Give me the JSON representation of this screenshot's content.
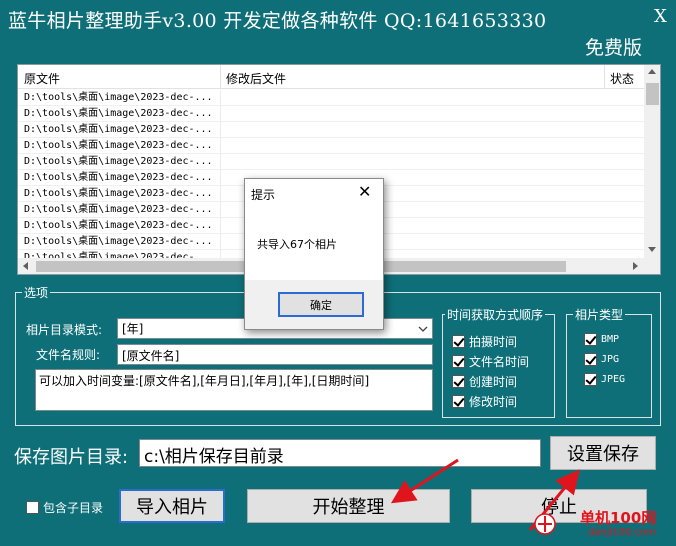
{
  "window": {
    "title": "蓝牛相片整理助手v3.00   开发定做各种软件   QQ:1641653330",
    "close": "X",
    "edition": "免费版"
  },
  "file_list": {
    "columns": [
      "原文件",
      "修改后文件",
      "状态"
    ],
    "rows": [
      "D:\\tools\\桌面\\image\\2023-dec-...",
      "D:\\tools\\桌面\\image\\2023-dec-...",
      "D:\\tools\\桌面\\image\\2023-dec-...",
      "D:\\tools\\桌面\\image\\2023-dec-...",
      "D:\\tools\\桌面\\image\\2023-dec-...",
      "D:\\tools\\桌面\\image\\2023-dec-...",
      "D:\\tools\\桌面\\image\\2023-dec-...",
      "D:\\tools\\桌面\\image\\2023-dec-...",
      "D:\\tools\\桌面\\image\\2023-dec-...",
      "D:\\tools\\桌面\\image\\2023-dec-...",
      "D:\\tools\\桌面\\image\\2023-dec-..."
    ]
  },
  "options": {
    "group_title": "选项",
    "dir_mode_label": "相片目录模式:",
    "dir_mode_value": "[年]",
    "name_rule_label": "文件名规则:",
    "name_rule_value": "[原文件名]",
    "hint": "可以加入时间变量:[原文件名],[年月日],[年月],[年],[日期时间]"
  },
  "time_order": {
    "title": "时间获取方式顺序",
    "items": [
      {
        "label": "拍摄时间",
        "checked": true
      },
      {
        "label": "文件名时间",
        "checked": true
      },
      {
        "label": "创建时间",
        "checked": true
      },
      {
        "label": "修改时间",
        "checked": true
      }
    ]
  },
  "photo_types": {
    "title": "相片类型",
    "items": [
      {
        "label": "BMP",
        "checked": true
      },
      {
        "label": "JPG",
        "checked": true
      },
      {
        "label": "JPEG",
        "checked": true
      }
    ]
  },
  "save": {
    "label": "保存图片目录:",
    "path": "c:\\相片保存目前录",
    "set_button": "设置保存"
  },
  "bottom": {
    "include_subdir": "包含子目录",
    "include_subdir_checked": false,
    "import_button": "导入相片",
    "start_button": "开始整理",
    "stop_button": "停止"
  },
  "dialog": {
    "title": "提示",
    "message": "共导入67个相片",
    "ok": "确定",
    "close": "✕"
  },
  "watermark": {
    "name": "单机100网",
    "url": "danji100.com"
  },
  "colors": {
    "background": "#0e6f79",
    "arrow": "#e0141c",
    "focus": "#2a6cd2"
  }
}
